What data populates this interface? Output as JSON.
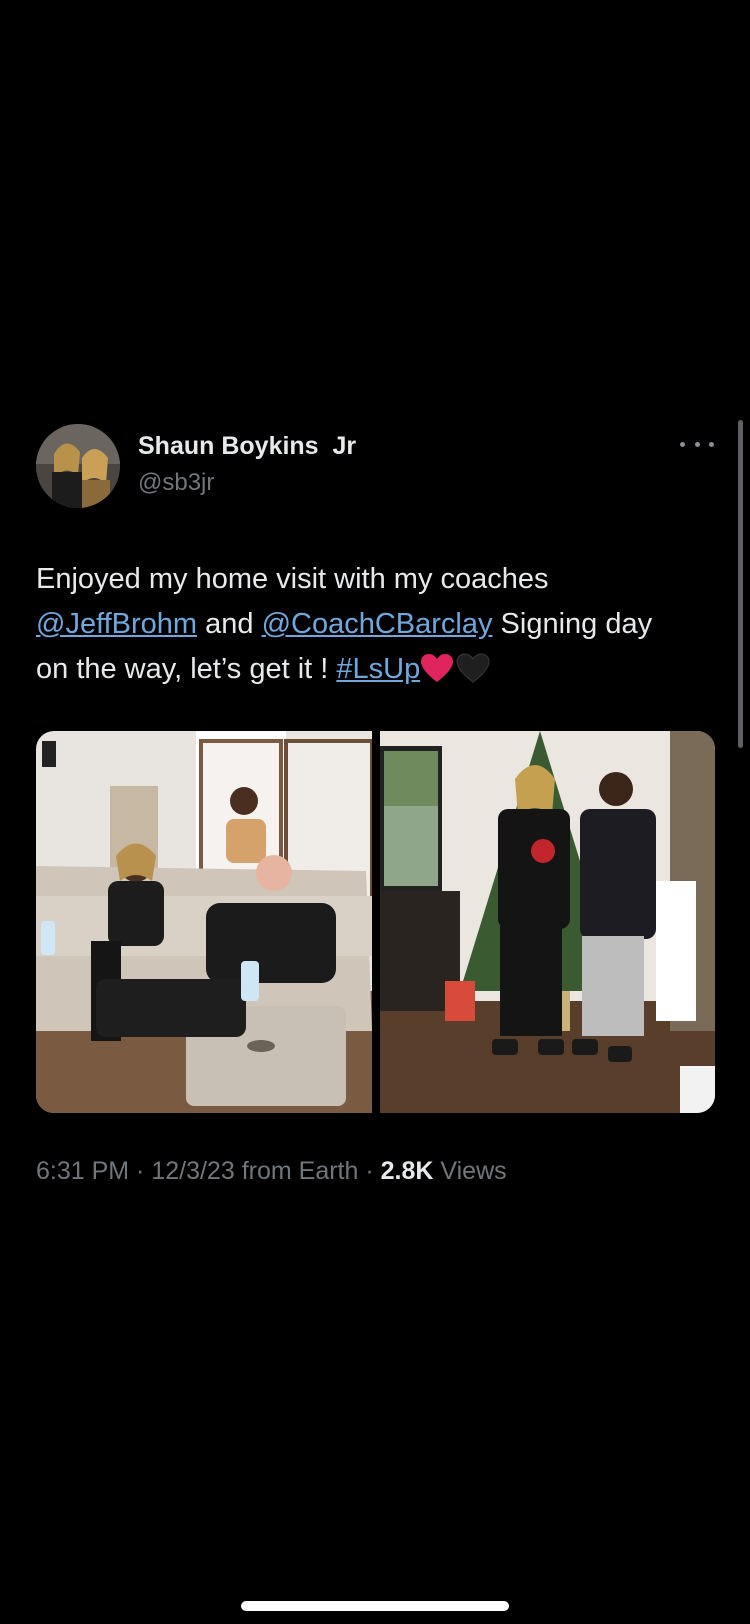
{
  "tweet": {
    "display_name": "Shaun Boykins  Jr",
    "handle": "@sb3jr",
    "text_1": "Enjoyed my home visit with my coaches ",
    "mention_1": "@JeffBrohm",
    "text_2": " and ",
    "mention_2": "@CoachCBarclay",
    "text_3": " Signing day on the way, let’s get it ! ",
    "hashtag": "#LsUp",
    "time": "6:31 PM",
    "separator_1": " · ",
    "date": "12/3/23",
    "source": " from Earth",
    "separator_2": " · ",
    "views_count": "2.8K",
    "views_label": " Views"
  },
  "media": {
    "photos": [
      {
        "alt_subject": "home-visit-living-room-photo"
      },
      {
        "alt_subject": "christmas-tree-photo"
      }
    ]
  },
  "colors": {
    "background": "#000000",
    "primary_text": "#e7e9ea",
    "secondary_text": "#71767b",
    "link": "#6fa8dc",
    "heart_red": "#e0245e",
    "heart_black": "#1f1f1f"
  },
  "icons": {
    "more": "more-horizontal-icon",
    "red_heart": "red-heart-emoji",
    "black_heart": "black-heart-emoji"
  }
}
